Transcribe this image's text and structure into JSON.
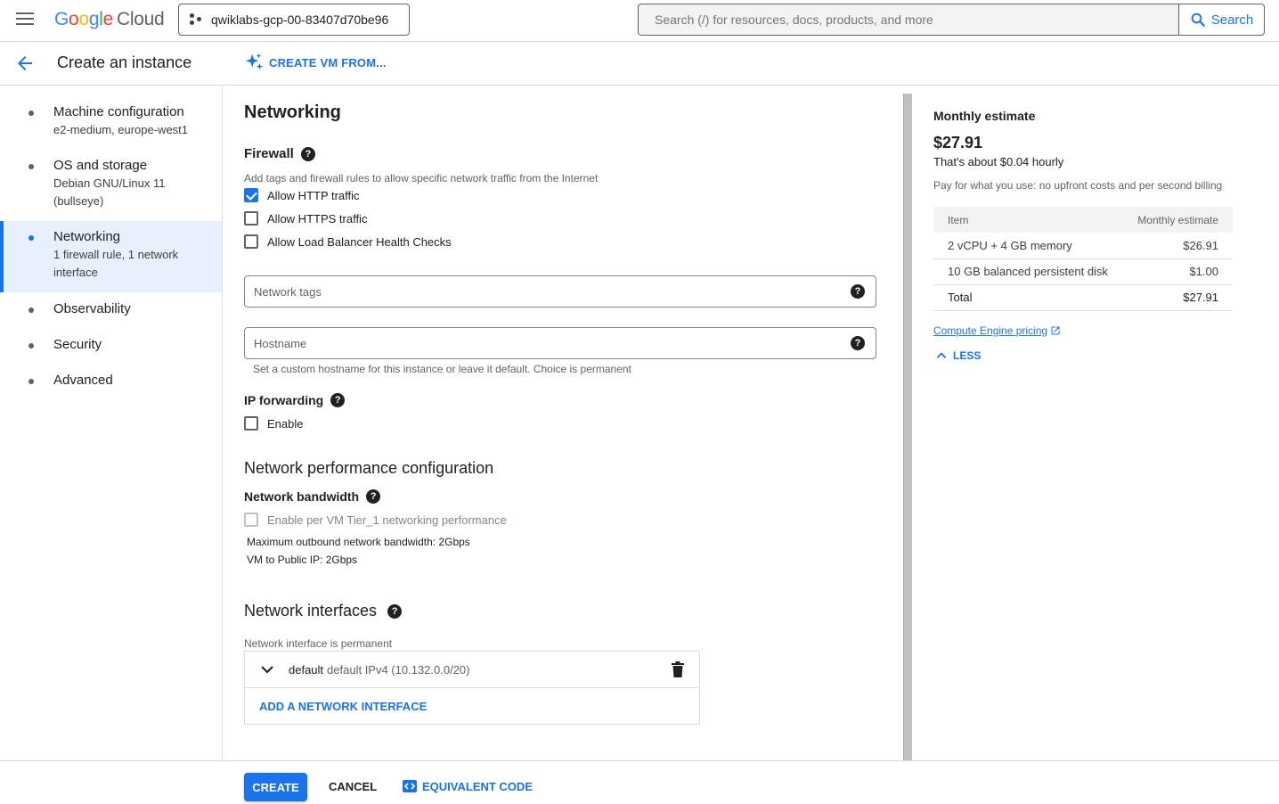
{
  "topbar": {
    "logo_google": "Google",
    "logo_cloud": "Cloud",
    "project": "qwiklabs-gcp-00-83407d70be96",
    "search_placeholder": "Search (/) for resources, docs, products, and more",
    "search_button": "Search"
  },
  "subheader": {
    "title": "Create an instance",
    "create_from": "CREATE VM FROM..."
  },
  "nav": {
    "items": [
      {
        "label": "Machine configuration",
        "sub1": "e2-medium, europe-west1",
        "sub2": ""
      },
      {
        "label": "OS and storage",
        "sub1": "Debian GNU/Linux 11",
        "sub2": "(bullseye)"
      },
      {
        "label": "Networking",
        "sub1": "1 firewall rule, 1 network",
        "sub2": "interface",
        "active": true
      },
      {
        "label": "Observability"
      },
      {
        "label": "Security"
      },
      {
        "label": "Advanced"
      }
    ]
  },
  "main": {
    "heading": "Networking",
    "firewall": {
      "title": "Firewall",
      "description": "Add tags and firewall rules to allow specific network traffic from the Internet",
      "options": [
        {
          "label": "Allow HTTP traffic",
          "checked": true
        },
        {
          "label": "Allow HTTPS traffic",
          "checked": false
        },
        {
          "label": "Allow Load Balancer Health Checks",
          "checked": false
        }
      ]
    },
    "network_tags_placeholder": "Network tags",
    "hostname_placeholder": "Hostname",
    "hostname_hint": "Set a custom hostname for this instance or leave it default. Choice is permanent",
    "ip_forwarding": {
      "title": "IP forwarding",
      "enable_label": "Enable"
    },
    "perf": {
      "title": "Network performance configuration",
      "bandwidth_title": "Network bandwidth",
      "tier1_label": "Enable per VM Tier_1 networking performance",
      "max_outbound": "Maximum outbound network bandwidth: 2Gbps",
      "public_ip": "VM to Public IP: 2Gbps"
    },
    "interfaces": {
      "title": "Network interfaces",
      "permanent_note": "Network interface is permanent",
      "items": [
        {
          "name": "default",
          "detail": "default IPv4 (10.132.0.0/20)"
        }
      ],
      "add_label": "ADD A NETWORK INTERFACE"
    }
  },
  "estimate": {
    "title": "Monthly estimate",
    "price": "$27.91",
    "hourly": "That's about $0.04 hourly",
    "pay_note": "Pay for what you use: no upfront costs and per second billing",
    "col_item": "Item",
    "col_monthly": "Monthly estimate",
    "rows": [
      {
        "item": "2 vCPU + 4 GB memory",
        "cost": "$26.91"
      },
      {
        "item": "10 GB balanced persistent disk",
        "cost": "$1.00"
      },
      {
        "item": "Total",
        "cost": "$27.91"
      }
    ],
    "pricing_link": "Compute Engine pricing",
    "less_label": "LESS"
  },
  "footer": {
    "create": "CREATE",
    "cancel": "CANCEL",
    "equivalent_code": "EQUIVALENT CODE"
  },
  "colors": {
    "accent": "#1a73e8",
    "active_nav_bg": "#e8f0fe",
    "border": "#dadce0"
  }
}
